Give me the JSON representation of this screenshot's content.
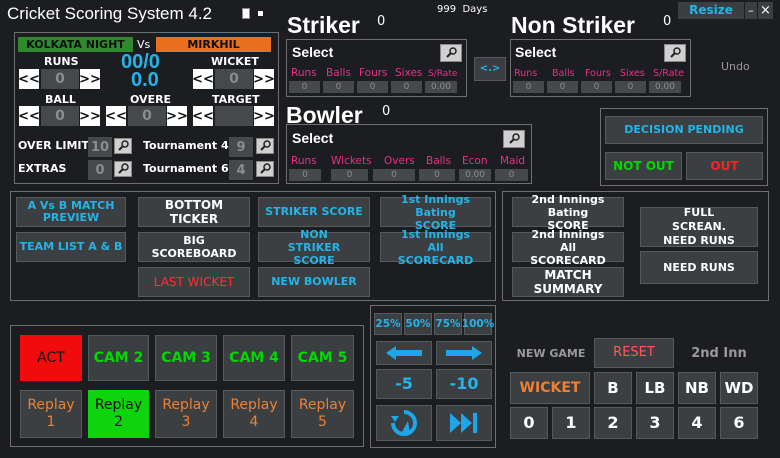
{
  "app": {
    "title": "Cricket Scoring System 4.2",
    "days": "999  Days",
    "resize": "Resize",
    "minimize": "–",
    "close": "×"
  },
  "match": {
    "team_a": "KOLKATA NIGHT",
    "vs": "Vs",
    "team_b": "MIRKHIL",
    "score": "00/0",
    "overs": "0.0",
    "runs_label": "RUNS",
    "wicket_label": "WICKET",
    "ball_label": "BALL",
    "overe_label": "OVERE",
    "target_label": "TARGET",
    "runs": "0",
    "wicket": "0",
    "ball": "0",
    "overe": "0",
    "target": "",
    "prev": "<<",
    "next": ">>"
  },
  "limits": {
    "over_limit_label": "OVER LIMIT",
    "over_limit": "10",
    "extras_label": "EXTRAS",
    "extras": "0",
    "tournament_a_label": "Tournament 4",
    "tournament_a": "9",
    "tournament_b_label": "Tournament 6",
    "tournament_b": "4"
  },
  "striker": {
    "heading": "Striker",
    "count": "0",
    "select": "Select",
    "stats_labels": [
      "Runs",
      "Balls",
      "Fours",
      "Sixes",
      "S/Rate"
    ],
    "stats_values": [
      "0",
      "0",
      "0",
      "0",
      "0.00"
    ]
  },
  "swap": "<.>",
  "non_striker": {
    "heading": "Non Striker",
    "count": "0",
    "select": "Select",
    "stats_labels": [
      "Runs",
      "Balls",
      "Fours",
      "Sixes",
      "S/Rate"
    ],
    "stats_values": [
      "0",
      "0",
      "0",
      "0",
      "0.00"
    ]
  },
  "undo": "Undo",
  "bowler": {
    "heading": "Bowler",
    "count": "0",
    "select": "Select",
    "stats_labels": [
      "Runs",
      "Wickets",
      "Overs",
      "Balls",
      "Econ",
      "Maid"
    ],
    "stats_values": [
      "0",
      "0",
      "0",
      "0",
      "0.00",
      "0"
    ]
  },
  "decision": {
    "pending": "DECISION PENDING",
    "not_out": "NOT OUT",
    "out": "OUT"
  },
  "graphics": {
    "match_preview": "A Vs  B  MATCH PREVIEW",
    "team_list": "TEAM LIST A & B",
    "bottom_ticker": "BOTTOM TICKER",
    "big_scoreboard": "BIG SCOREBOARD",
    "last_wicket": "LAST WICKET",
    "striker_score": "STRIKER SCORE",
    "non_striker_score": "NON STRIKER SCORE",
    "new_bowler": "NEW BOWLER",
    "inn1_bating": "1st Innings Bating SCORE",
    "inn1_all": "1st Innings All SCORECARD"
  },
  "graphics2": {
    "inn2_bating": "2nd Innings Bating SCORE",
    "inn2_all": "2nd Innings All SCORECARD",
    "match_summary": "MATCH SUMMARY",
    "full_screen": "FULL SCREAN. NEED RUNS",
    "need_runs": "NEED RUNS"
  },
  "cams": {
    "act": "ACT",
    "cam2": "CAM 2",
    "cam3": "CAM 3",
    "cam4": "CAM 4",
    "cam5": "CAM 5",
    "replays": [
      {
        "label": "Replay",
        "num": "1"
      },
      {
        "label": "Replay",
        "num": "2"
      },
      {
        "label": "Replay",
        "num": "3"
      },
      {
        "label": "Replay",
        "num": "4"
      },
      {
        "label": "Replay",
        "num": "5"
      }
    ]
  },
  "playback": {
    "speeds": [
      "25%",
      "50%",
      "75%",
      "100%"
    ],
    "minus5": "-5",
    "minus10": "-10"
  },
  "scoring": {
    "new_game": "NEW GAME",
    "reset": "RESET",
    "second_inn": "2nd Inn",
    "wicket": "WICKET",
    "b": "B",
    "lb": "LB",
    "nb": "NB",
    "wd": "WD",
    "runs": [
      "0",
      "1",
      "2",
      "3",
      "4",
      "6"
    ]
  },
  "colors": {
    "accent": "#25b3e8",
    "green": "#00d800",
    "red": "#ff2020",
    "pink": "#e8308a",
    "orange": "#f08030"
  }
}
